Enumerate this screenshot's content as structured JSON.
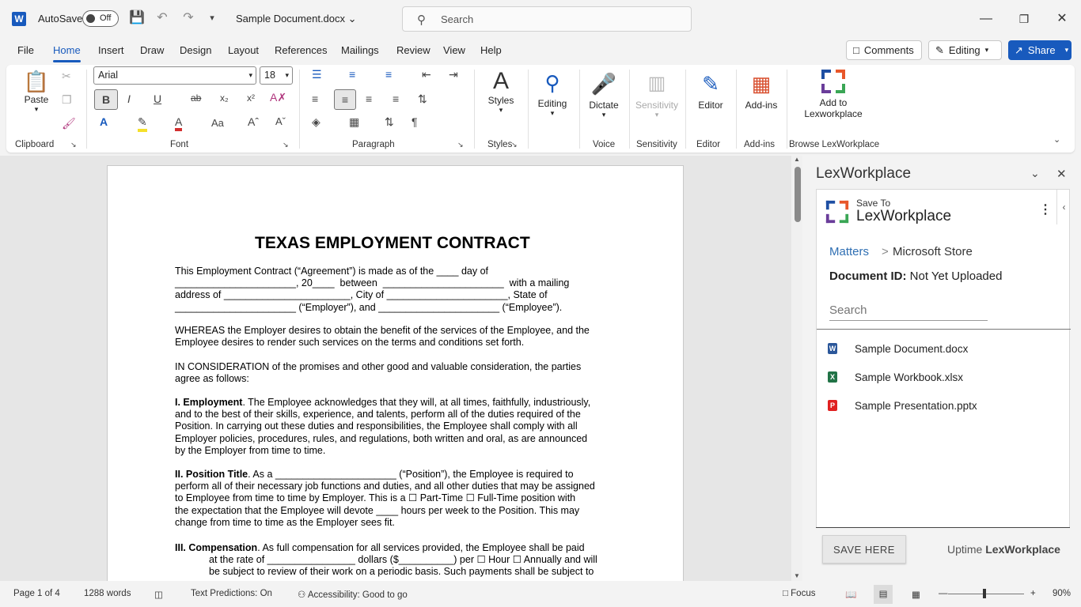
{
  "titlebar": {
    "app_letter": "W",
    "autosave_label": "AutoSave",
    "autosave_state": "Off",
    "doc_title": "Sample Document.docx",
    "search_placeholder": "Search"
  },
  "tabs": [
    "File",
    "Home",
    "Insert",
    "Draw",
    "Design",
    "Layout",
    "References",
    "Mailings",
    "Review",
    "View",
    "Help"
  ],
  "active_tab": "Home",
  "top_buttons": {
    "comments": "Comments",
    "editing": "Editing",
    "share": "Share"
  },
  "ribbon": {
    "paste": "Paste",
    "font_name": "Arial",
    "font_size": "18",
    "styles": "Styles",
    "editing": "Editing",
    "dictate": "Dictate",
    "sensitivity": "Sensitivity",
    "editor": "Editor",
    "addins": "Add-ins",
    "add_to_lex": "Add to",
    "add_to_lex2": "Lexworkplace",
    "groups": {
      "clipboard": "Clipboard",
      "font": "Font",
      "paragraph": "Paragraph",
      "styles": "Styles",
      "voice": "Voice",
      "sensitivity": "Sensitivity",
      "editor": "Editor",
      "addins": "Add-ins",
      "browse": "Browse LexWorkplace"
    }
  },
  "document": {
    "heading": "TEXAS EMPLOYMENT CONTRACT",
    "p1": [
      "This Employment Contract (“Agreement”) is made as of the ____ day of",
      "______________________, 20____  between  ______________________  with a mailing",
      "address of _______________________, City of ______________________, State of",
      "______________________ (“Employer”), and ______________________ (“Employee”)."
    ],
    "p2": [
      "WHEREAS the Employer desires to obtain the benefit of the services of the Employee, and the",
      "Employee desires to render such services on the terms and conditions set forth."
    ],
    "p3": [
      "IN CONSIDERATION of the promises and other good and valuable consideration, the parties",
      "agree as follows:"
    ],
    "p4_head": "I. Employment",
    "p4": [
      ". The Employee acknowledges that they will, at all times, faithfully, industriously,",
      "and to the best of their skills, experience, and talents, perform all of the duties required of the",
      "Position. In carrying out these duties and responsibilities, the Employee shall comply with all",
      "Employer policies, procedures, rules, and regulations, both written and oral, as are announced",
      "by the Employer from time to time."
    ],
    "p5_head": "II. Position Title",
    "p5": [
      ". As a ______________________ (“Position”), the Employee is required to",
      "perform all of their necessary job functions and duties, and all other duties that may be assigned",
      "to Employee from time to time by Employer. This is a ☐ Part-Time ☐ Full-Time position with",
      "the expectation that the Employee will devote ____ hours per week to the Position. This may",
      "change from time to time as the Employer sees fit."
    ],
    "p6_head": "III. Compensation",
    "p6": [
      ". As full compensation for all services provided, the Employee shall be paid",
      "at the rate of ________________ dollars ($__________) per ☐ Hour ☐ Annually and will",
      "be subject to review of their work on a periodic basis. Such payments shall be subject to"
    ]
  },
  "pane": {
    "title": "LexWorkplace",
    "save_to": "Save To",
    "brand": "LexWorkplace",
    "crumb_link": "Matters",
    "crumb_sep": ">",
    "crumb_current": "Microsoft Store",
    "docid_label": "Document ID:",
    "docid_value": "Not Yet Uploaded",
    "search_placeholder": "Search",
    "files": [
      {
        "name": "Sample Document.docx",
        "type": "word",
        "color": "#2b579a",
        "letter": "W"
      },
      {
        "name": "Sample Workbook.xlsx",
        "type": "excel",
        "color": "#217346",
        "letter": "X"
      },
      {
        "name": "Sample Presentation.pptx",
        "type": "pdf",
        "color": "#e02020",
        "letter": "P"
      }
    ],
    "save_button": "SAVE HERE",
    "uptime_prefix": "Uptime",
    "uptime_brand": "LexWorkplace"
  },
  "status": {
    "page": "Page 1 of 4",
    "words": "1288 words",
    "predictions": "Text Predictions: On",
    "accessibility": "Accessibility: Good to go",
    "focus": "Focus",
    "zoom": "90%"
  }
}
